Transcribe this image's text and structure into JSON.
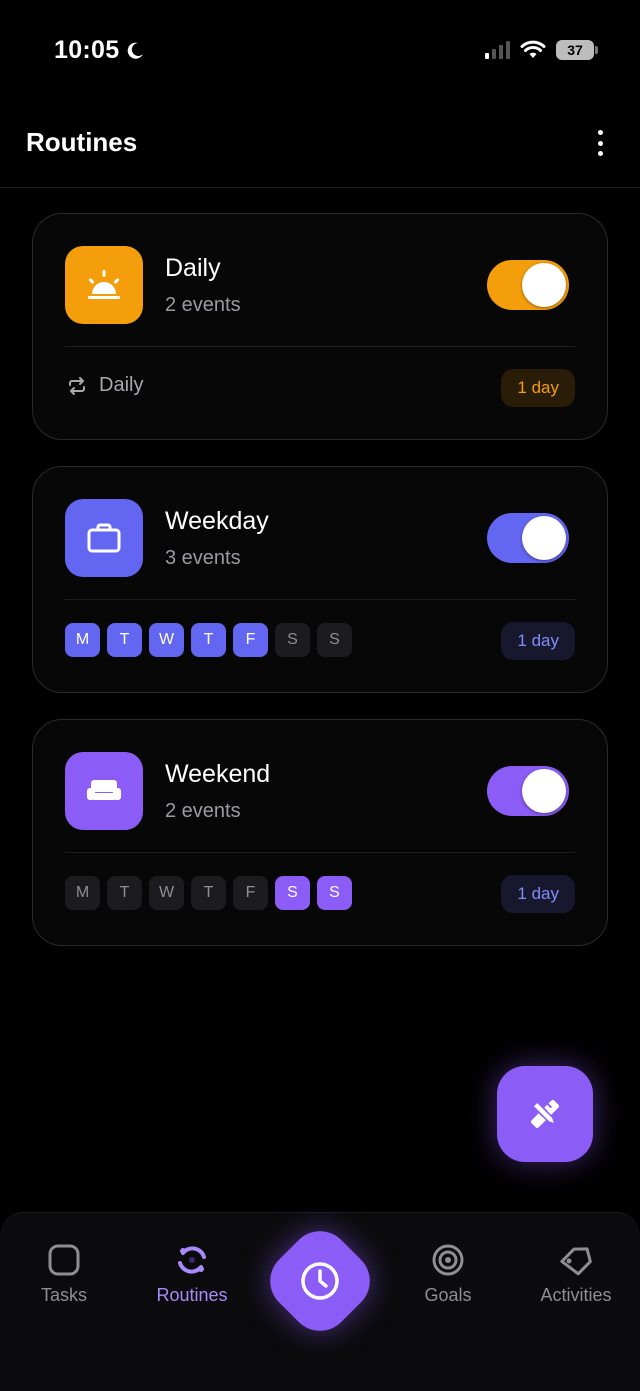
{
  "status_bar": {
    "time": "10:05",
    "battery": "37",
    "moon_icon": "moon-icon"
  },
  "header": {
    "title": "Routines"
  },
  "routines": [
    {
      "name": "Daily",
      "events": "2 events",
      "icon": "sunrise-icon",
      "color": "#f59e0b",
      "enabled": true,
      "repeat_label": "Daily",
      "duration": "1 day",
      "badge_bg": "#2a1d07",
      "badge_fg": "#f59e0b"
    },
    {
      "name": "Weekday",
      "events": "3 events",
      "icon": "briefcase-icon",
      "color": "#6366f1",
      "enabled": true,
      "days": [
        "M",
        "T",
        "W",
        "T",
        "F",
        "S",
        "S"
      ],
      "active_days": [
        true,
        true,
        true,
        true,
        true,
        false,
        false
      ],
      "duration": "1 day",
      "badge_bg": "#17172e",
      "badge_fg": "#818cf8"
    },
    {
      "name": "Weekend",
      "events": "2 events",
      "icon": "sofa-icon",
      "color": "#8b5cf6",
      "enabled": true,
      "days": [
        "M",
        "T",
        "W",
        "T",
        "F",
        "S",
        "S"
      ],
      "active_days": [
        false,
        false,
        false,
        false,
        false,
        true,
        true
      ],
      "duration": "1 day",
      "badge_bg": "#17172e",
      "badge_fg": "#818cf8"
    }
  ],
  "fab": {
    "icon": "tools-icon"
  },
  "nav": {
    "items": [
      {
        "label": "Tasks",
        "icon": "square-icon",
        "active": false
      },
      {
        "label": "Routines",
        "icon": "refresh-circle-icon",
        "active": true
      },
      {
        "label": "",
        "icon": "clock-icon",
        "active": false
      },
      {
        "label": "Goals",
        "icon": "target-icon",
        "active": false
      },
      {
        "label": "Activities",
        "icon": "tag-icon",
        "active": false
      }
    ]
  },
  "colors": {
    "accent": "#8b5cf6",
    "background": "#000000"
  }
}
